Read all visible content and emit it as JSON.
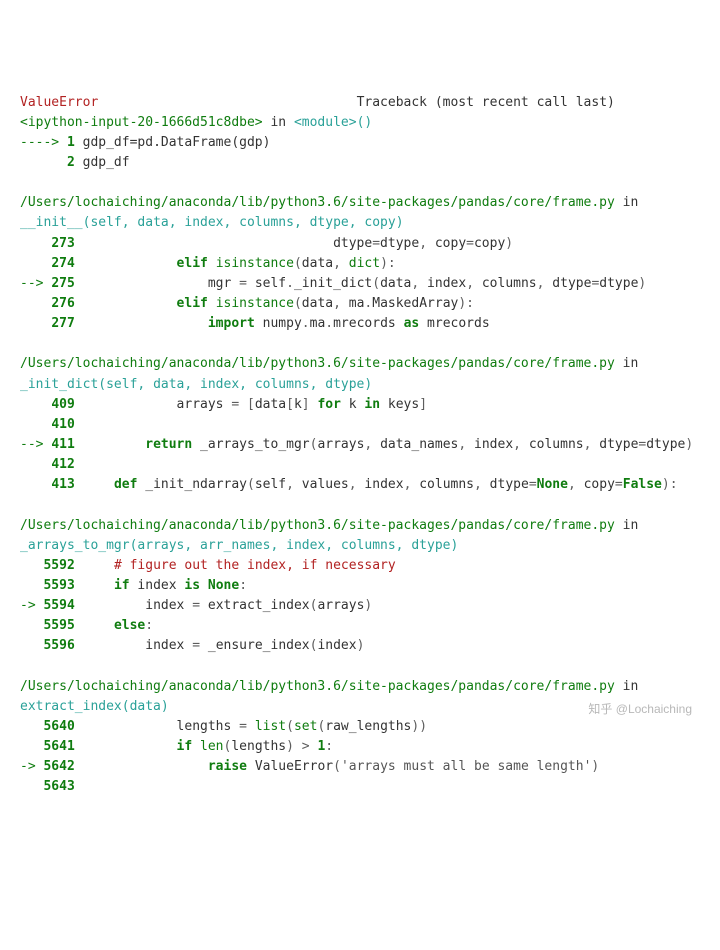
{
  "header": {
    "error_name": "ValueError",
    "traceback_label": "Traceback (most recent call last)"
  },
  "input_frame": {
    "source": "<ipython-input-20-1666d51c8dbe>",
    "in_text": " in ",
    "module": "<module>",
    "paren": "()",
    "lines": [
      {
        "arrow": "----> ",
        "num": "1",
        "code": " gdp_df=pd.DataFrame(gdp)"
      },
      {
        "arrow": "      ",
        "num": "2",
        "code": " gdp_df"
      }
    ]
  },
  "frames": [
    {
      "path": "/Users/lochaiching/anaconda/lib/python3.6/site-packages/pandas/core/frame.py",
      "in_text": " in ",
      "func": "__init__",
      "sig": "(self, data, index, columns, dtype, copy)",
      "lines": [
        {
          "arrow": "    ",
          "num": "273",
          "pad": "                                 ",
          "tokens": [
            [
              "id",
              "dtype"
            ],
            [
              "op",
              "="
            ],
            [
              "id",
              "dtype"
            ],
            [
              "op",
              ", "
            ],
            [
              "id",
              "copy"
            ],
            [
              "op",
              "="
            ],
            [
              "id",
              "copy"
            ],
            [
              "op",
              ")"
            ]
          ]
        },
        {
          "arrow": "    ",
          "num": "274",
          "pad": "             ",
          "tokens": [
            [
              "kw",
              "elif"
            ],
            [
              "op",
              " "
            ],
            [
              "builtin",
              "isinstance"
            ],
            [
              "op",
              "("
            ],
            [
              "id",
              "data"
            ],
            [
              "op",
              ", "
            ],
            [
              "builtin",
              "dict"
            ],
            [
              "op",
              "):"
            ]
          ]
        },
        {
          "arrow": "--> ",
          "num": "275",
          "pad": "                 ",
          "tokens": [
            [
              "id",
              "mgr"
            ],
            [
              "op",
              " = "
            ],
            [
              "id",
              "self"
            ],
            [
              "op",
              "."
            ],
            [
              "id",
              "_init_dict"
            ],
            [
              "op",
              "("
            ],
            [
              "id",
              "data"
            ],
            [
              "op",
              ", "
            ],
            [
              "id",
              "index"
            ],
            [
              "op",
              ", "
            ],
            [
              "id",
              "columns"
            ],
            [
              "op",
              ", "
            ],
            [
              "id",
              "dtype"
            ],
            [
              "op",
              "="
            ],
            [
              "id",
              "dtype"
            ],
            [
              "op",
              ")"
            ]
          ]
        },
        {
          "arrow": "    ",
          "num": "276",
          "pad": "             ",
          "tokens": [
            [
              "kw",
              "elif"
            ],
            [
              "op",
              " "
            ],
            [
              "builtin",
              "isinstance"
            ],
            [
              "op",
              "("
            ],
            [
              "id",
              "data"
            ],
            [
              "op",
              ", "
            ],
            [
              "id",
              "ma"
            ],
            [
              "op",
              "."
            ],
            [
              "id",
              "MaskedArray"
            ],
            [
              "op",
              "):"
            ]
          ]
        },
        {
          "arrow": "    ",
          "num": "277",
          "pad": "                 ",
          "tokens": [
            [
              "kw",
              "import"
            ],
            [
              "op",
              " "
            ],
            [
              "id",
              "numpy"
            ],
            [
              "op",
              "."
            ],
            [
              "id",
              "ma"
            ],
            [
              "op",
              "."
            ],
            [
              "id",
              "mrecords"
            ],
            [
              "op",
              " "
            ],
            [
              "kw",
              "as"
            ],
            [
              "op",
              " "
            ],
            [
              "id",
              "mrecords"
            ]
          ]
        }
      ]
    },
    {
      "path": "/Users/lochaiching/anaconda/lib/python3.6/site-packages/pandas/core/frame.py",
      "in_text": " in ",
      "func": "_init_dict",
      "sig": "(self, data, index, columns, dtype)",
      "lines": [
        {
          "arrow": "    ",
          "num": "409",
          "pad": "             ",
          "tokens": [
            [
              "id",
              "arrays"
            ],
            [
              "op",
              " = ["
            ],
            [
              "id",
              "data"
            ],
            [
              "op",
              "["
            ],
            [
              "id",
              "k"
            ],
            [
              "op",
              "] "
            ],
            [
              "kw",
              "for"
            ],
            [
              "op",
              " "
            ],
            [
              "id",
              "k"
            ],
            [
              "op",
              " "
            ],
            [
              "kw",
              "in"
            ],
            [
              "op",
              " "
            ],
            [
              "id",
              "keys"
            ],
            [
              "op",
              "]"
            ]
          ]
        },
        {
          "arrow": "    ",
          "num": "410",
          "pad": "",
          "tokens": []
        },
        {
          "arrow": "--> ",
          "num": "411",
          "pad": "         ",
          "tokens": [
            [
              "kw",
              "return"
            ],
            [
              "op",
              " "
            ],
            [
              "id",
              "_arrays_to_mgr"
            ],
            [
              "op",
              "("
            ],
            [
              "id",
              "arrays"
            ],
            [
              "op",
              ", "
            ],
            [
              "id",
              "data_names"
            ],
            [
              "op",
              ", "
            ],
            [
              "id",
              "index"
            ],
            [
              "op",
              ", "
            ],
            [
              "id",
              "columns"
            ],
            [
              "op",
              ", "
            ],
            [
              "id",
              "dtype"
            ],
            [
              "op",
              "="
            ],
            [
              "id",
              "dtype"
            ],
            [
              "op",
              ")"
            ]
          ]
        },
        {
          "arrow": "    ",
          "num": "412",
          "pad": "",
          "tokens": []
        },
        {
          "arrow": "    ",
          "num": "413",
          "pad": "     ",
          "tokens": [
            [
              "kw",
              "def"
            ],
            [
              "op",
              " "
            ],
            [
              "id",
              "_init_ndarray"
            ],
            [
              "op",
              "("
            ],
            [
              "id",
              "self"
            ],
            [
              "op",
              ", "
            ],
            [
              "id",
              "values"
            ],
            [
              "op",
              ", "
            ],
            [
              "id",
              "index"
            ],
            [
              "op",
              ", "
            ],
            [
              "id",
              "columns"
            ],
            [
              "op",
              ", "
            ],
            [
              "id",
              "dtype"
            ],
            [
              "op",
              "="
            ],
            [
              "kw",
              "None"
            ],
            [
              "op",
              ", "
            ],
            [
              "id",
              "copy"
            ],
            [
              "op",
              "="
            ],
            [
              "kw",
              "False"
            ],
            [
              "op",
              "):"
            ]
          ]
        }
      ]
    },
    {
      "path": "/Users/lochaiching/anaconda/lib/python3.6/site-packages/pandas/core/frame.py",
      "in_text": " in ",
      "func": "_arrays_to_mgr",
      "sig": "(arrays, arr_names, index, columns, dtype)",
      "lines": [
        {
          "arrow": "   ",
          "num": "5592",
          "pad": "     ",
          "tokens": [
            [
              "cmt",
              "# figure out the index, if necessary"
            ]
          ]
        },
        {
          "arrow": "   ",
          "num": "5593",
          "pad": "     ",
          "tokens": [
            [
              "kw",
              "if"
            ],
            [
              "op",
              " "
            ],
            [
              "id",
              "index"
            ],
            [
              "op",
              " "
            ],
            [
              "kw",
              "is"
            ],
            [
              "op",
              " "
            ],
            [
              "kw",
              "None"
            ],
            [
              "op",
              ":"
            ]
          ]
        },
        {
          "arrow": "-> ",
          "num": "5594",
          "pad": "         ",
          "tokens": [
            [
              "id",
              "index"
            ],
            [
              "op",
              " = "
            ],
            [
              "id",
              "extract_index"
            ],
            [
              "op",
              "("
            ],
            [
              "id",
              "arrays"
            ],
            [
              "op",
              ")"
            ]
          ]
        },
        {
          "arrow": "   ",
          "num": "5595",
          "pad": "     ",
          "tokens": [
            [
              "kw",
              "else"
            ],
            [
              "op",
              ":"
            ]
          ]
        },
        {
          "arrow": "   ",
          "num": "5596",
          "pad": "         ",
          "tokens": [
            [
              "id",
              "index"
            ],
            [
              "op",
              " = "
            ],
            [
              "id",
              "_ensure_index"
            ],
            [
              "op",
              "("
            ],
            [
              "id",
              "index"
            ],
            [
              "op",
              ")"
            ]
          ]
        }
      ]
    },
    {
      "path": "/Users/lochaiching/anaconda/lib/python3.6/site-packages/pandas/core/frame.py",
      "in_text": " in ",
      "func": "extract_index",
      "sig": "(data)",
      "lines": [
        {
          "arrow": "   ",
          "num": "5640",
          "pad": "             ",
          "tokens": [
            [
              "id",
              "lengths"
            ],
            [
              "op",
              " = "
            ],
            [
              "builtin",
              "list"
            ],
            [
              "op",
              "("
            ],
            [
              "builtin",
              "set"
            ],
            [
              "op",
              "("
            ],
            [
              "id",
              "raw_lengths"
            ],
            [
              "op",
              "))"
            ]
          ]
        },
        {
          "arrow": "   ",
          "num": "5641",
          "pad": "             ",
          "tokens": [
            [
              "kw",
              "if"
            ],
            [
              "op",
              " "
            ],
            [
              "builtin",
              "len"
            ],
            [
              "op",
              "("
            ],
            [
              "id",
              "lengths"
            ],
            [
              "op",
              ") > "
            ],
            [
              "num",
              "1"
            ],
            [
              "op",
              ":"
            ]
          ]
        },
        {
          "arrow": "-> ",
          "num": "5642",
          "pad": "                 ",
          "tokens": [
            [
              "kw",
              "raise"
            ],
            [
              "op",
              " "
            ],
            [
              "id",
              "ValueError"
            ],
            [
              "op",
              "("
            ],
            [
              "str",
              "'arrays must all be same length'"
            ],
            [
              "op",
              ")"
            ]
          ]
        },
        {
          "arrow": "   ",
          "num": "5643",
          "pad": "",
          "tokens": []
        }
      ]
    }
  ],
  "watermark": "知乎 @Lochaiching"
}
